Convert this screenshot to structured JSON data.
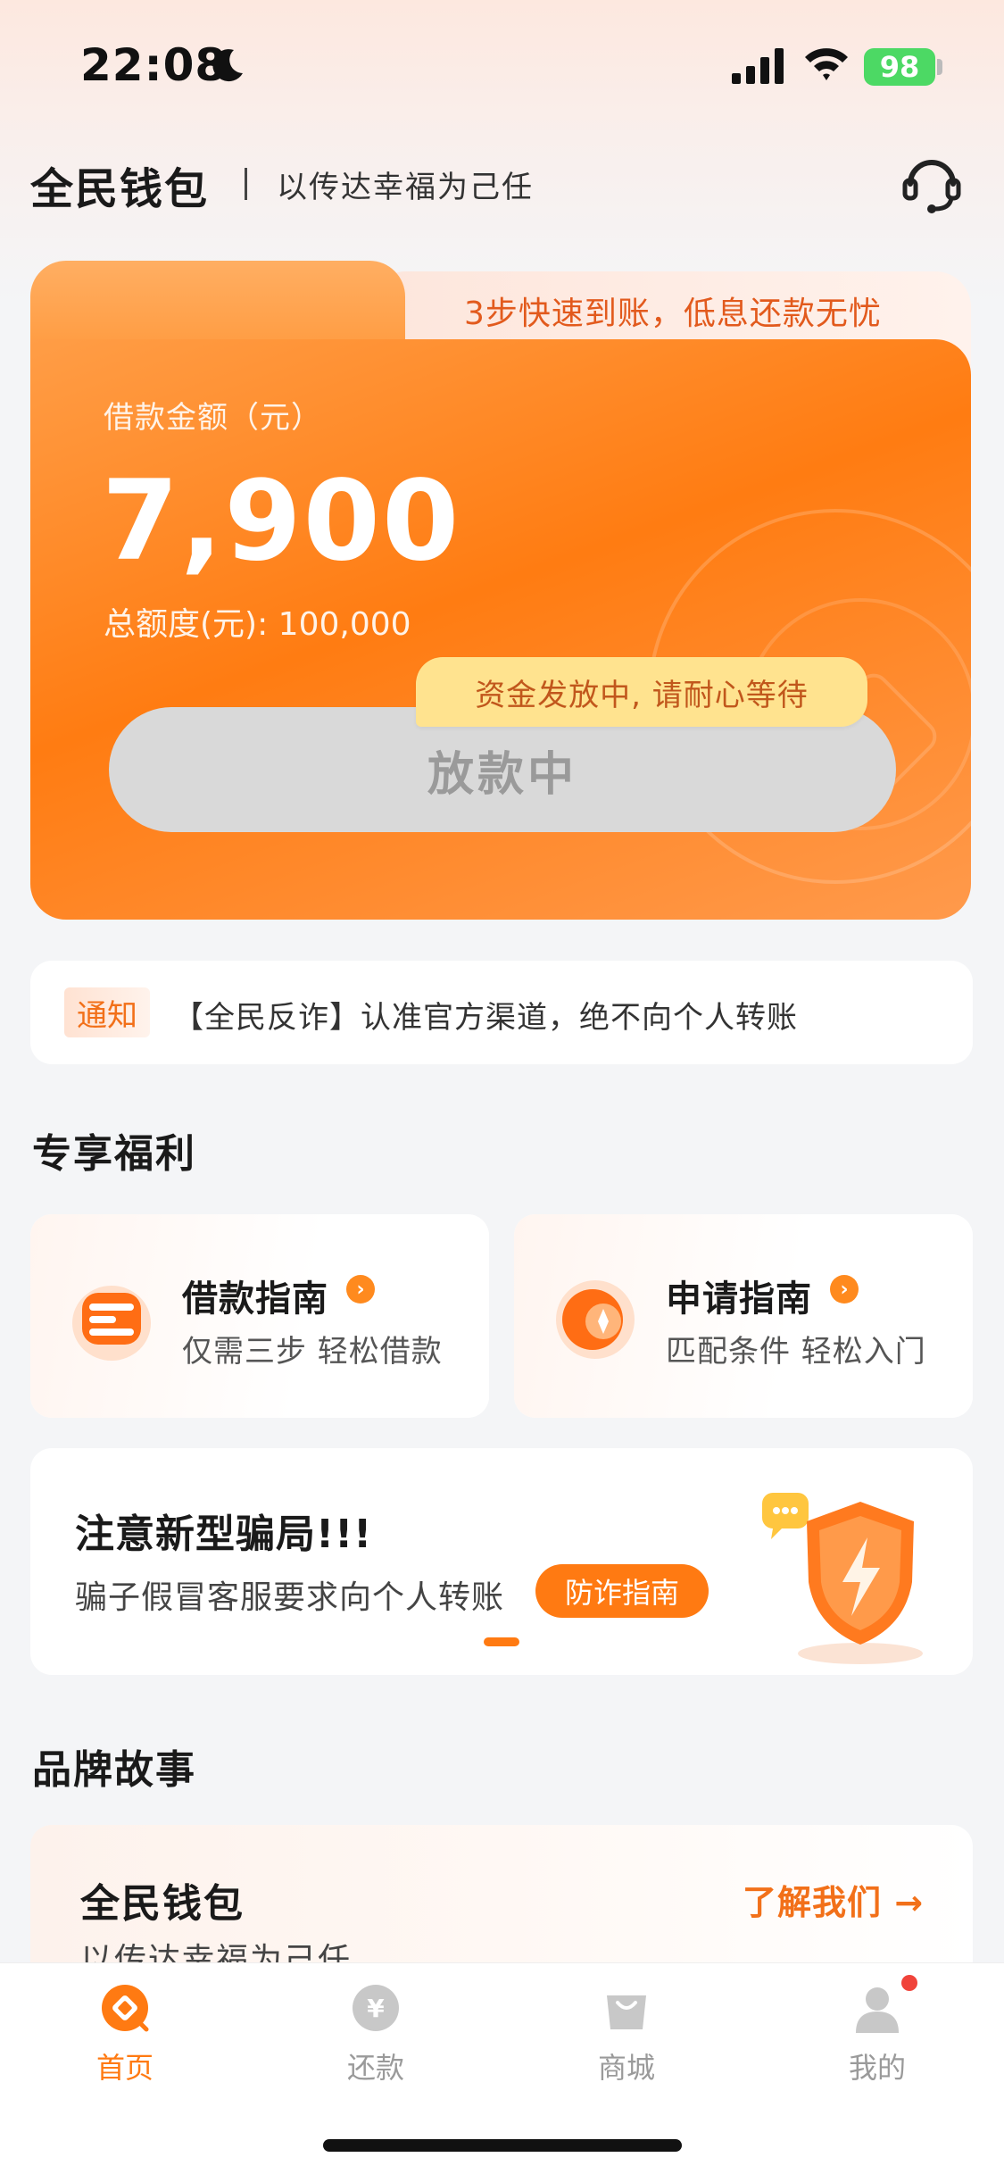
{
  "status_bar": {
    "time": "22:08",
    "battery": "98"
  },
  "header": {
    "title": "全民钱包",
    "slogan": "以传达幸福为己任"
  },
  "loan_card": {
    "slogan": "3步快速到账，低息还款无忧",
    "amount_label": "借款金额（元）",
    "amount": "7,900",
    "total_limit": "总额度(元): 100,000",
    "status_tip": "资金发放中, 请耐心等待",
    "status_button": "放款中"
  },
  "notice": {
    "tag": "通知",
    "text": "【全民反诈】认准官方渠道，绝不向个人转账"
  },
  "benefits": {
    "title": "专享福利",
    "cards": [
      {
        "title": "借款指南",
        "subtitle": "仅需三步 轻松借款"
      },
      {
        "title": "申请指南",
        "subtitle": "匹配条件 轻松入门"
      }
    ]
  },
  "warning": {
    "title": "注意新型骗局!!!",
    "text": "骗子假冒客服要求向个人转账",
    "button": "防诈指南"
  },
  "brand": {
    "section_title": "品牌故事",
    "name": "全民钱包",
    "slogan": "以传达幸福为己任",
    "link": "了解我们 →"
  },
  "tabbar": {
    "items": [
      {
        "label": "首页",
        "icon": "home-icon",
        "active": true
      },
      {
        "label": "还款",
        "icon": "repay-icon",
        "active": false
      },
      {
        "label": "商城",
        "icon": "shop-icon",
        "active": false
      },
      {
        "label": "我的",
        "icon": "profile-icon",
        "active": false
      }
    ]
  },
  "colors": {
    "accent": "#ff7a12",
    "card_orange": "#ff8a24",
    "tip_yellow": "#ffe38f",
    "status_green": "#4cd964"
  }
}
